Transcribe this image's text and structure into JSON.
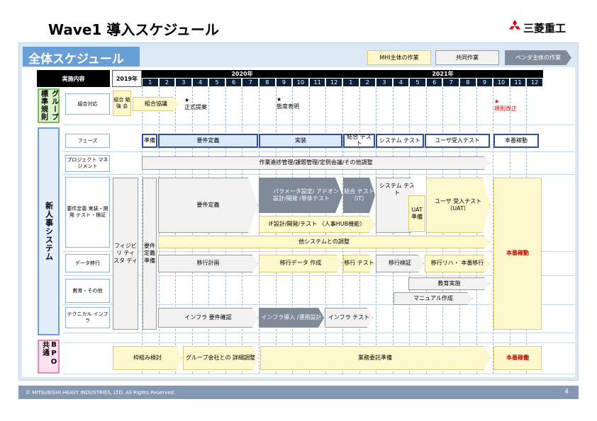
{
  "title": "Wave1 導入スケジュール",
  "brand": "三菱重工",
  "section_title": "全体スケジュール",
  "legend": {
    "mhi": "MHI主体の作業",
    "joint": "共同作業",
    "vendor": "ベンダ主体の作業"
  },
  "header": {
    "content": "実施内容",
    "y2019": "2019年",
    "y2020": "2020年",
    "y2021": "2021年"
  },
  "months": [
    "1",
    "2",
    "3",
    "4",
    "5",
    "6",
    "7",
    "8",
    "9",
    "10",
    "11",
    "12",
    "1",
    "2",
    "3",
    "4",
    "5",
    "6",
    "7",
    "8",
    "9",
    "10",
    "11",
    "12"
  ],
  "categories": {
    "group": "グループ標準規則",
    "system": "新人事システム",
    "bpo": "BPO共通"
  },
  "rows": {
    "kumiai": "組合対応",
    "phase": "フェーズ",
    "pm": "プロジェクト マネジメント",
    "dev": "要件定義 実装・開発 テスト・検証",
    "migration": "データ移行",
    "edu": "教育・その他",
    "infra": "テクニカル インフラ"
  },
  "bars": {
    "kumiai_study": "組合 勉強 会",
    "kumiai_talks": "組合協議",
    "proposal": "正式提案",
    "intent": "態度表明",
    "revision": "規則改正",
    "ph_prep": "準備",
    "ph_req": "要件定義",
    "ph_impl": "実装",
    "ph_it": "結合 テスト",
    "ph_st": "システム テスト",
    "ph_uat": "ユーザ受入テスト",
    "ph_live": "本番稼動",
    "pm_bar": "作業進捗管理/課題管理/定例会議/その他調整",
    "feasibility": "フィジビリ ティスタ ディ",
    "req_prep": "要件 定義 準備",
    "req_def": "要件定義",
    "param": "パラメータ設定/ アドオン設計/開発 /単体テスト",
    "it": "結合 テスト （IT）",
    "st": "システム テスト",
    "uat_prep": "UAT 準備",
    "uat": "ユーザ 受入テスト （UAT）",
    "live_main": "本番稼動",
    "if_design": "IF設計/開発/テスト （人事HUB機能）",
    "other_sys": "他システムとの調整",
    "mig_plan": "移行計画",
    "mig_data": "移行データ 作成",
    "mig_test": "移行 テスト",
    "mig_verify": "移行検証",
    "mig_rehearsal": "移行リハ・ 本番移行",
    "edu_exec": "教育実施",
    "manual": "マニュアル作成",
    "infra_req": "インフラ 要件確認",
    "infra_intro": "インフラ導入 /運用設計",
    "infra_test": "インフラ テスト",
    "bpo_frame": "枠組み検討",
    "bpo_group": "グループ会社との 詳細調整",
    "bpo_prep": "業務委託準備",
    "bpo_live": "本番稼働"
  },
  "star_symbol": "★",
  "colors": {
    "mhi": "#fff8cc",
    "joint": "#f2f2f2",
    "vendor": "#7f8b99",
    "accent": "#6a9fd6",
    "red": "#cc0000"
  },
  "footer": {
    "copyright": "© MITSUBISHI HEAVY INDUSTRIES, LTD.  All Rights Reserved.",
    "page": "4"
  }
}
